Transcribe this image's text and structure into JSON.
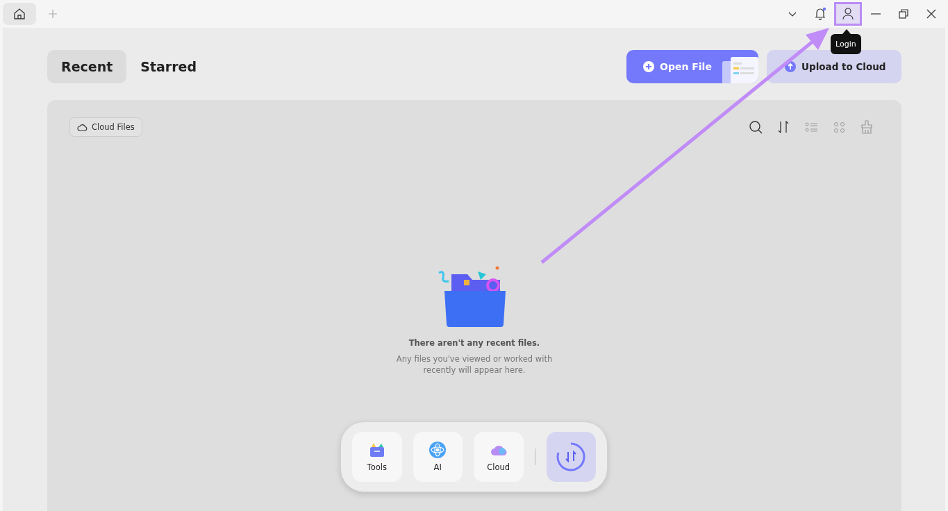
{
  "notifications": {
    "unread": true
  },
  "account": {
    "highlighted": true,
    "tooltip": "Login"
  },
  "view_tabs": [
    {
      "label": "Recent",
      "selected": true
    },
    {
      "label": "Starred",
      "selected": false
    }
  ],
  "actions": [
    {
      "kind": "primary",
      "label": "Open File"
    },
    {
      "kind": "secondary",
      "label": "Upload to Cloud"
    }
  ],
  "panel": {
    "filter_chip": "Cloud Files",
    "empty_state": {
      "title": "There aren't any recent files.",
      "message": "Any files you've viewed or worked with recently will appear here."
    }
  },
  "dock": {
    "items": [
      {
        "kind": "tools",
        "label": "Tools"
      },
      {
        "kind": "ai",
        "label": "AI"
      },
      {
        "kind": "cloud",
        "label": "Cloud"
      }
    ]
  }
}
